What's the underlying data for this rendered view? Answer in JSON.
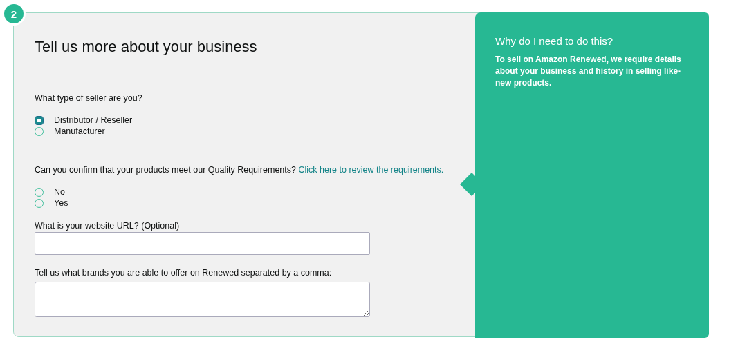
{
  "step": {
    "number": "2"
  },
  "form": {
    "title": "Tell us more about your business",
    "questions": [
      {
        "kind": "radio",
        "label": "What type of seller are you?",
        "options": [
          {
            "label": "Distributor / Reseller",
            "selected": true
          },
          {
            "label": "Manufacturer",
            "selected": false
          }
        ]
      },
      {
        "kind": "radio",
        "label": "Can you confirm that your products meet our Quality Requirements?",
        "link": "Click here to review the requirements.",
        "options": [
          {
            "label": "No",
            "selected": false
          },
          {
            "label": "Yes",
            "selected": false
          }
        ]
      },
      {
        "kind": "text",
        "label": "What is your website URL? (Optional)"
      },
      {
        "kind": "textarea",
        "label": "Tell us what brands you are able to offer on Renewed separated by a comma:"
      }
    ]
  },
  "help": {
    "title": "Why do I need to do this?",
    "body": "To sell on Amazon Renewed, we require details about your business and history in selling like-new products."
  }
}
